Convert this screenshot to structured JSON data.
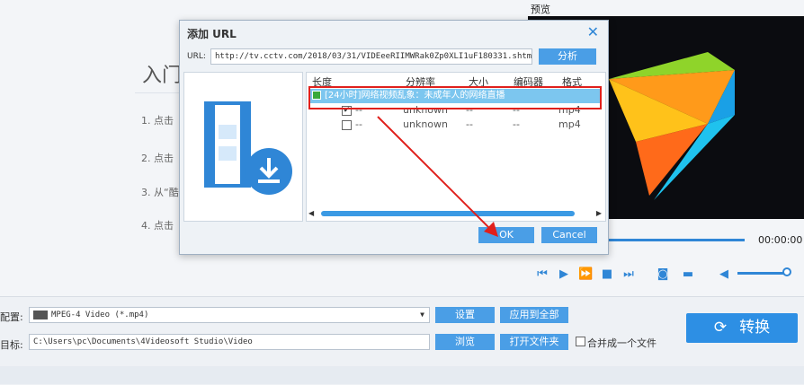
{
  "intro": {
    "title": "入门",
    "steps": [
      "1. 点击",
      "2. 点击",
      "3. 从“酷",
      "4. 点击"
    ]
  },
  "preview": {
    "label": "预览",
    "time": "00:00:00"
  },
  "dialog": {
    "title": "添加 URL",
    "url_label": "URL:",
    "url_value": "http://tv.cctv.com/2018/03/31/VIDEeeRIIMWRak0Zp0XLI1uF180331.shtml",
    "analyze": "分析",
    "columns": [
      "长度",
      "分辨率",
      "大小",
      "编码器",
      "格式"
    ],
    "group_title": "[24小时]网络视频乱象：未成年人的网络直播",
    "rows": [
      {
        "checked": true,
        "length": "--",
        "resolution": "unknown",
        "size": "--",
        "codec": "--",
        "format": "mp4"
      },
      {
        "checked": false,
        "length": "--",
        "resolution": "unknown",
        "size": "--",
        "codec": "--",
        "format": "mp4"
      }
    ],
    "ok": "OK",
    "cancel": "Cancel"
  },
  "bottom": {
    "profile_label": "配置:",
    "profile_value": "MPEG-4 Video (*.mp4)",
    "settings": "设置",
    "apply_all": "应用到全部",
    "dest_label": "目标:",
    "dest_value": "C:\\Users\\pc\\Documents\\4Videosoft Studio\\Video",
    "browse": "浏览",
    "open_folder": "打开文件夹",
    "merge": "合并成一个文件",
    "convert": "转换"
  },
  "colors": {
    "accent": "#2f86d6",
    "highlight_box": "#e0201c"
  }
}
